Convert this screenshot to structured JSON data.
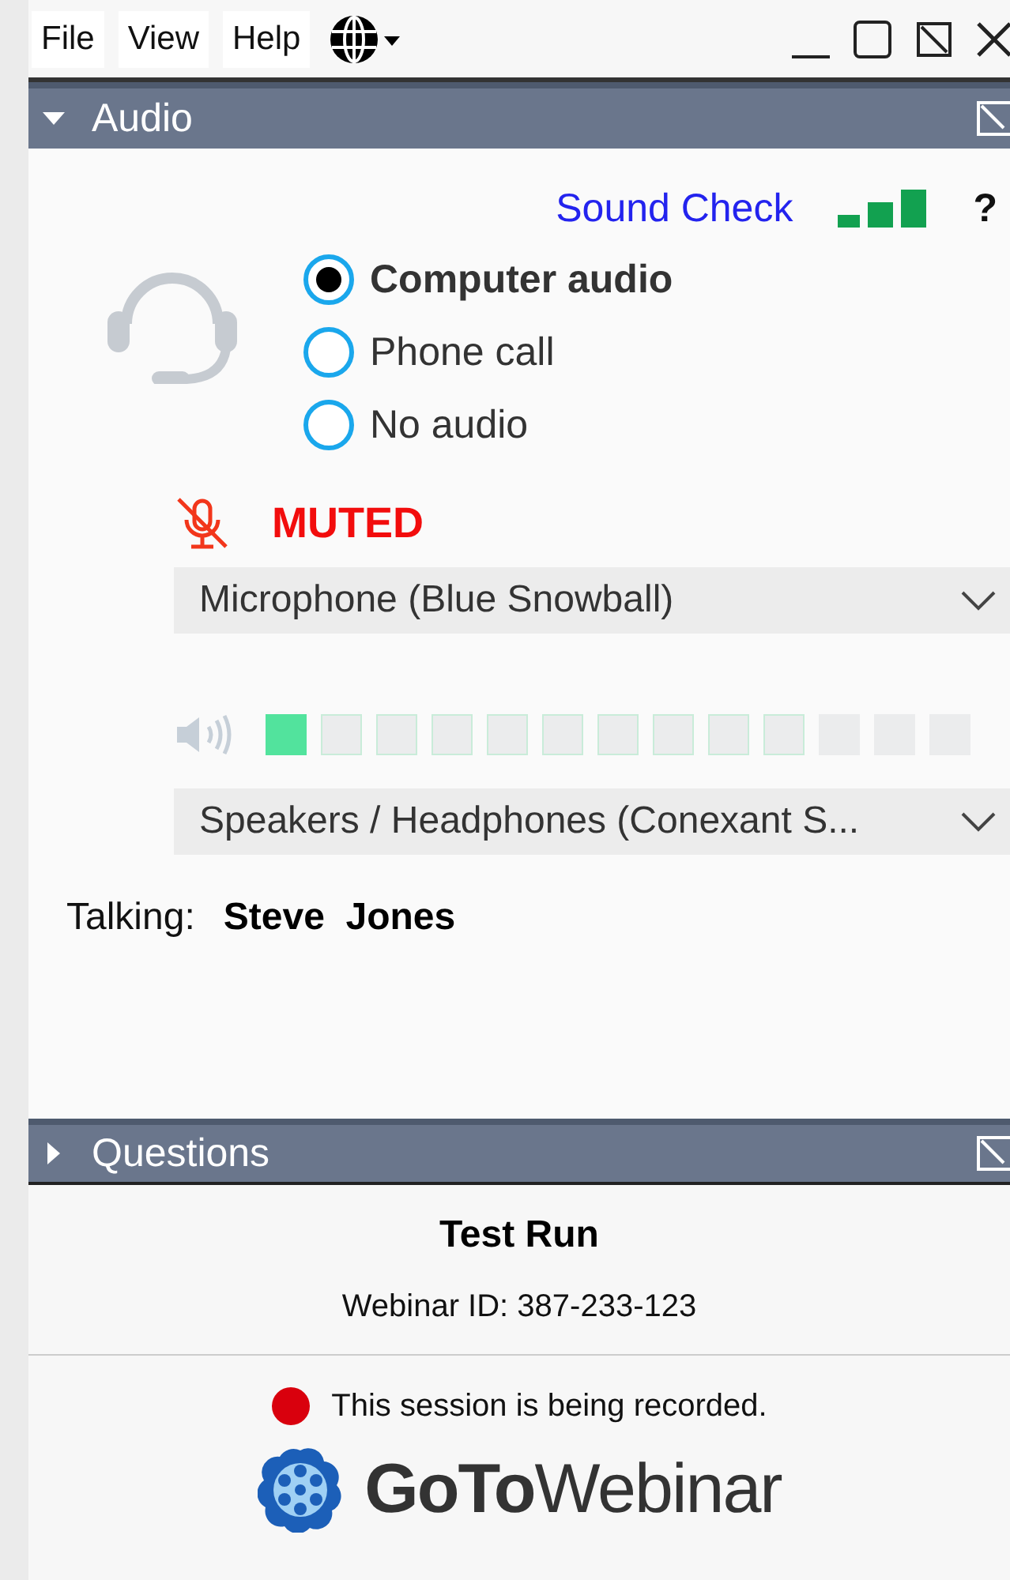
{
  "menu": [
    {
      "label": "File"
    },
    {
      "label": "View"
    },
    {
      "label": "Help"
    }
  ],
  "audio": {
    "title": "Audio",
    "expanded": true,
    "sound_check": "Sound Check",
    "help": "?",
    "options": [
      {
        "label": "Computer audio",
        "selected": true
      },
      {
        "label": "Phone call",
        "selected": false
      },
      {
        "label": "No audio",
        "selected": false
      }
    ],
    "muted": true,
    "mute_label": "MUTED",
    "microphone": "Microphone (Blue Snowball)",
    "speaker_meter": {
      "level": 0.08
    },
    "speakers": "Speakers / Headphones (Conexant S...",
    "talking_label": "Talking:",
    "talking_name": "Steve  Jones"
  },
  "questions": {
    "title": "Questions",
    "expanded": false
  },
  "webinar": {
    "title": "Test Run",
    "id": "Webinar ID: 387-233-123",
    "recording": "This session is being recorded.",
    "logo": "**GoTo**Webinar"
  }
}
